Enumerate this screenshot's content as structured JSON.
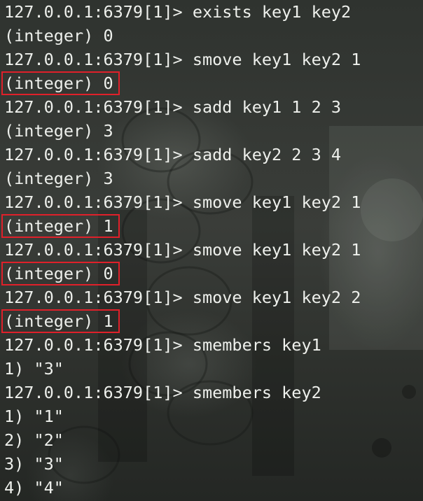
{
  "prompt": "127.0.0.1:6379[1]>",
  "lines": [
    {
      "type": "cmd",
      "text": "exists key1 key2"
    },
    {
      "type": "out",
      "text": "(integer) 0",
      "highlight": false
    },
    {
      "type": "cmd",
      "text": "smove key1 key2 1"
    },
    {
      "type": "out",
      "text": "(integer) 0",
      "highlight": true
    },
    {
      "type": "cmd",
      "text": "sadd key1 1 2 3"
    },
    {
      "type": "out",
      "text": "(integer) 3",
      "highlight": false
    },
    {
      "type": "cmd",
      "text": "sadd key2 2 3 4"
    },
    {
      "type": "out",
      "text": "(integer) 3",
      "highlight": false
    },
    {
      "type": "cmd",
      "text": "smove key1 key2 1"
    },
    {
      "type": "out",
      "text": "(integer) 1",
      "highlight": true
    },
    {
      "type": "cmd",
      "text": "smove key1 key2 1"
    },
    {
      "type": "out",
      "text": "(integer) 0",
      "highlight": true
    },
    {
      "type": "cmd",
      "text": "smove key1 key2 2"
    },
    {
      "type": "out",
      "text": "(integer) 1",
      "highlight": true
    },
    {
      "type": "cmd",
      "text": "smembers key1"
    },
    {
      "type": "out",
      "text": "1) \"3\"",
      "highlight": false
    },
    {
      "type": "cmd",
      "text": "smembers key2"
    },
    {
      "type": "out",
      "text": "1) \"1\"",
      "highlight": false
    },
    {
      "type": "out",
      "text": "2) \"2\"",
      "highlight": false
    },
    {
      "type": "out",
      "text": "3) \"3\"",
      "highlight": false
    },
    {
      "type": "out",
      "text": "4) \"4\"",
      "highlight": false
    }
  ],
  "colors": {
    "text": "#eef0ec",
    "highlight_border": "#e0202a",
    "background": "#2f332f"
  }
}
